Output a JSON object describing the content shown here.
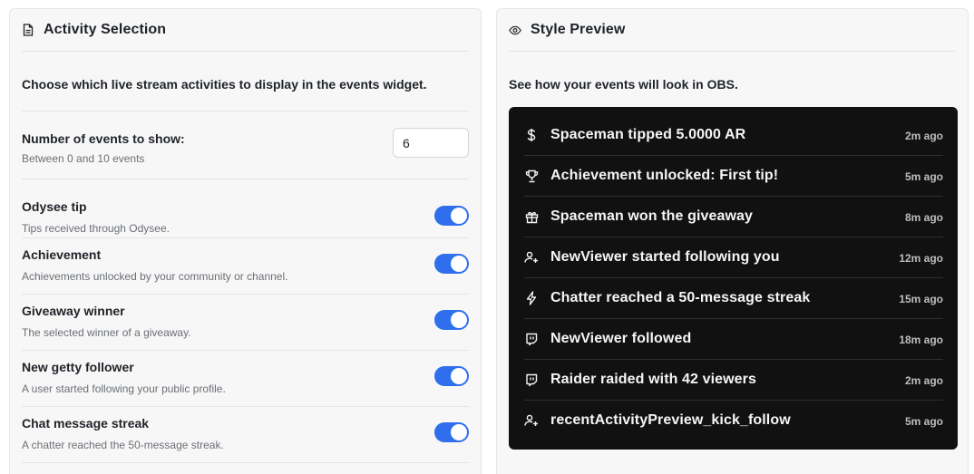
{
  "activity_panel": {
    "title": "Activity Selection",
    "title_icon": "document-icon",
    "description": "Choose which live stream activities to display in the events widget.",
    "count_setting": {
      "label": "Number of events to show:",
      "help": "Between 0 and 10 events",
      "value": "6"
    },
    "activities": [
      {
        "name": "Odysee tip",
        "help": "Tips received through Odysee.",
        "enabled": true
      },
      {
        "name": "Achievement",
        "help": "Achievements unlocked by your community or channel.",
        "enabled": true
      },
      {
        "name": "Giveaway winner",
        "help": "The selected winner of a giveaway.",
        "enabled": true
      },
      {
        "name": "New getty follower",
        "help": "A user started following your public profile.",
        "enabled": true
      },
      {
        "name": "Chat message streak",
        "help": "A chatter reached the 50-message streak.",
        "enabled": true
      }
    ]
  },
  "preview_panel": {
    "title": "Style Preview",
    "title_icon": "eye-icon",
    "description": "See how your events will look in OBS.",
    "events": [
      {
        "icon": "dollar-icon",
        "text": "Spaceman tipped 5.0000 AR",
        "time": "2m ago"
      },
      {
        "icon": "trophy-icon",
        "text": "Achievement unlocked: First tip!",
        "time": "5m ago"
      },
      {
        "icon": "gift-icon",
        "text": "Spaceman won the giveaway",
        "time": "8m ago"
      },
      {
        "icon": "user-plus-icon",
        "text": "NewViewer started following you",
        "time": "12m ago"
      },
      {
        "icon": "lightning-icon",
        "text": "Chatter reached a 50-message streak",
        "time": "15m ago"
      },
      {
        "icon": "twitch-icon",
        "text": "NewViewer followed",
        "time": "18m ago"
      },
      {
        "icon": "twitch-icon",
        "text": "Raider raided with 42 viewers",
        "time": "2m ago"
      },
      {
        "icon": "user-plus-icon",
        "text": "recentActivityPreview_kick_follow",
        "time": "5m ago"
      }
    ]
  },
  "colors": {
    "accent": "#2f6fed",
    "panel_bg": "#f7f7f7",
    "preview_bg": "#111111",
    "text_dark": "#1f2328",
    "text_muted": "#6b6f75"
  }
}
